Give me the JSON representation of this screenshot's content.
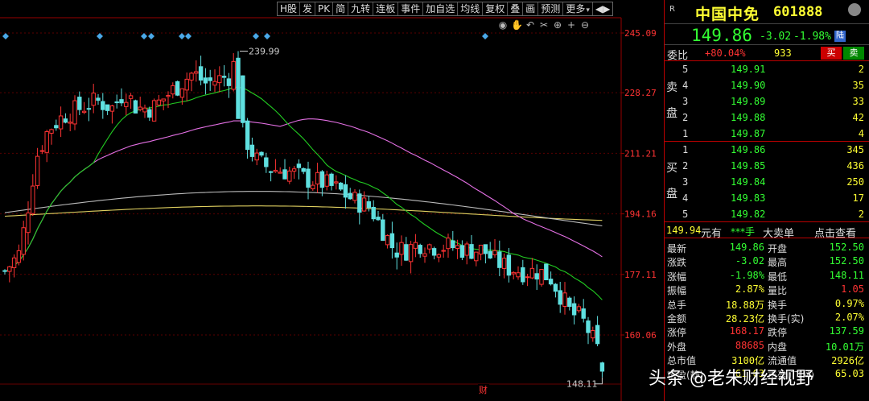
{
  "toolbar": {
    "items": [
      "H股",
      "发",
      "PK",
      "简",
      "九转",
      "连板",
      "事件",
      "加自选",
      "均线",
      "复权",
      "叠",
      "画",
      "预测",
      "更多",
      "◀▶"
    ]
  },
  "chart_icons": [
    "eye-icon",
    "hand-icon",
    "undo-icon",
    "scissors-icon",
    "circle-plus-icon",
    "plus-icon",
    "circle-minus-icon"
  ],
  "chart": {
    "price_axis": [
      "245.09",
      "228.27",
      "211.21",
      "194.16",
      "177.11",
      "160.06"
    ],
    "high_label": "239.99",
    "low_label": "148.11",
    "event_marker": "财",
    "colors": {
      "up": "#ff3333",
      "down": "#5fe0e0",
      "ma5": "#ffffff",
      "ma20": "#22cc22",
      "ma60": "#e36fe3",
      "ma120": "#bbbbbb",
      "ma250": "#e0d060"
    }
  },
  "quote": {
    "mark": "R",
    "name": "中国中免",
    "code": "601888",
    "price": "149.86",
    "change": "-3.02",
    "change_pct": "-1.98%",
    "tag": "陆",
    "ratio_label": "委比",
    "ratio_pct": "+80.04%",
    "ratio_diff": "933",
    "buy_btn": "买",
    "sell_btn": "卖"
  },
  "asks_label": [
    "卖",
    "盘"
  ],
  "bids_label": [
    "买",
    "盘"
  ],
  "asks": [
    {
      "level": "5",
      "price": "149.91",
      "volume": "2"
    },
    {
      "level": "4",
      "price": "149.90",
      "volume": "35"
    },
    {
      "level": "3",
      "price": "149.89",
      "volume": "33"
    },
    {
      "level": "2",
      "price": "149.88",
      "volume": "42"
    },
    {
      "level": "1",
      "price": "149.87",
      "volume": "4"
    }
  ],
  "bids": [
    {
      "level": "1",
      "price": "149.86",
      "volume": "345"
    },
    {
      "level": "2",
      "price": "149.85",
      "volume": "436"
    },
    {
      "level": "3",
      "price": "149.84",
      "volume": "250"
    },
    {
      "level": "4",
      "price": "149.83",
      "volume": "17"
    },
    {
      "level": "5",
      "price": "149.82",
      "volume": "2"
    }
  ],
  "mid": {
    "value": "149.94",
    "unit": "元有",
    "hidden": "***手",
    "big_order": "大卖单",
    "check": "点击查看"
  },
  "stats": [
    {
      "k1": "最新",
      "v1": "149.86",
      "c1": "#3f3",
      "k2": "开盘",
      "v2": "152.50",
      "c2": "#3f3"
    },
    {
      "k1": "涨跌",
      "v1": "-3.02",
      "c1": "#3f3",
      "k2": "最高",
      "v2": "152.50",
      "c2": "#3f3"
    },
    {
      "k1": "涨幅",
      "v1": "-1.98%",
      "c1": "#3f3",
      "k2": "最低",
      "v2": "148.11",
      "c2": "#3f3"
    },
    {
      "k1": "振幅",
      "v1": "2.87%",
      "c1": "#ff3",
      "k2": "量比",
      "v2": "1.05",
      "c2": "#f33"
    },
    {
      "k1": "总手",
      "v1": "18.88万",
      "c1": "#ff3",
      "k2": "换手",
      "v2": "0.97%",
      "c2": "#ff3"
    },
    {
      "k1": "金额",
      "v1": "28.23亿",
      "c1": "#ff3",
      "k2": "换手(实)",
      "v2": "2.07%",
      "c2": "#ff3"
    },
    {
      "k1": "涨停",
      "v1": "168.17",
      "c1": "#f33",
      "k2": "跌停",
      "v2": "137.59",
      "c2": "#3f3"
    },
    {
      "k1": "外盘",
      "v1": "88685",
      "c1": "#f33",
      "k2": "内盘",
      "v2": "10.01万",
      "c2": "#3f3"
    },
    {
      "k1": "总市值",
      "v1": "3100亿",
      "c1": "#ff3",
      "k2": "流通值",
      "v2": "2926亿",
      "c2": "#ff3"
    },
    {
      "k1": "市盈(静)",
      "v1": "61.63",
      "c1": "#ff3",
      "k2": "市盈(TTM)",
      "v2": "65.03",
      "c2": "#ff3"
    }
  ],
  "watermark": "头条 @老朱财经视野"
}
